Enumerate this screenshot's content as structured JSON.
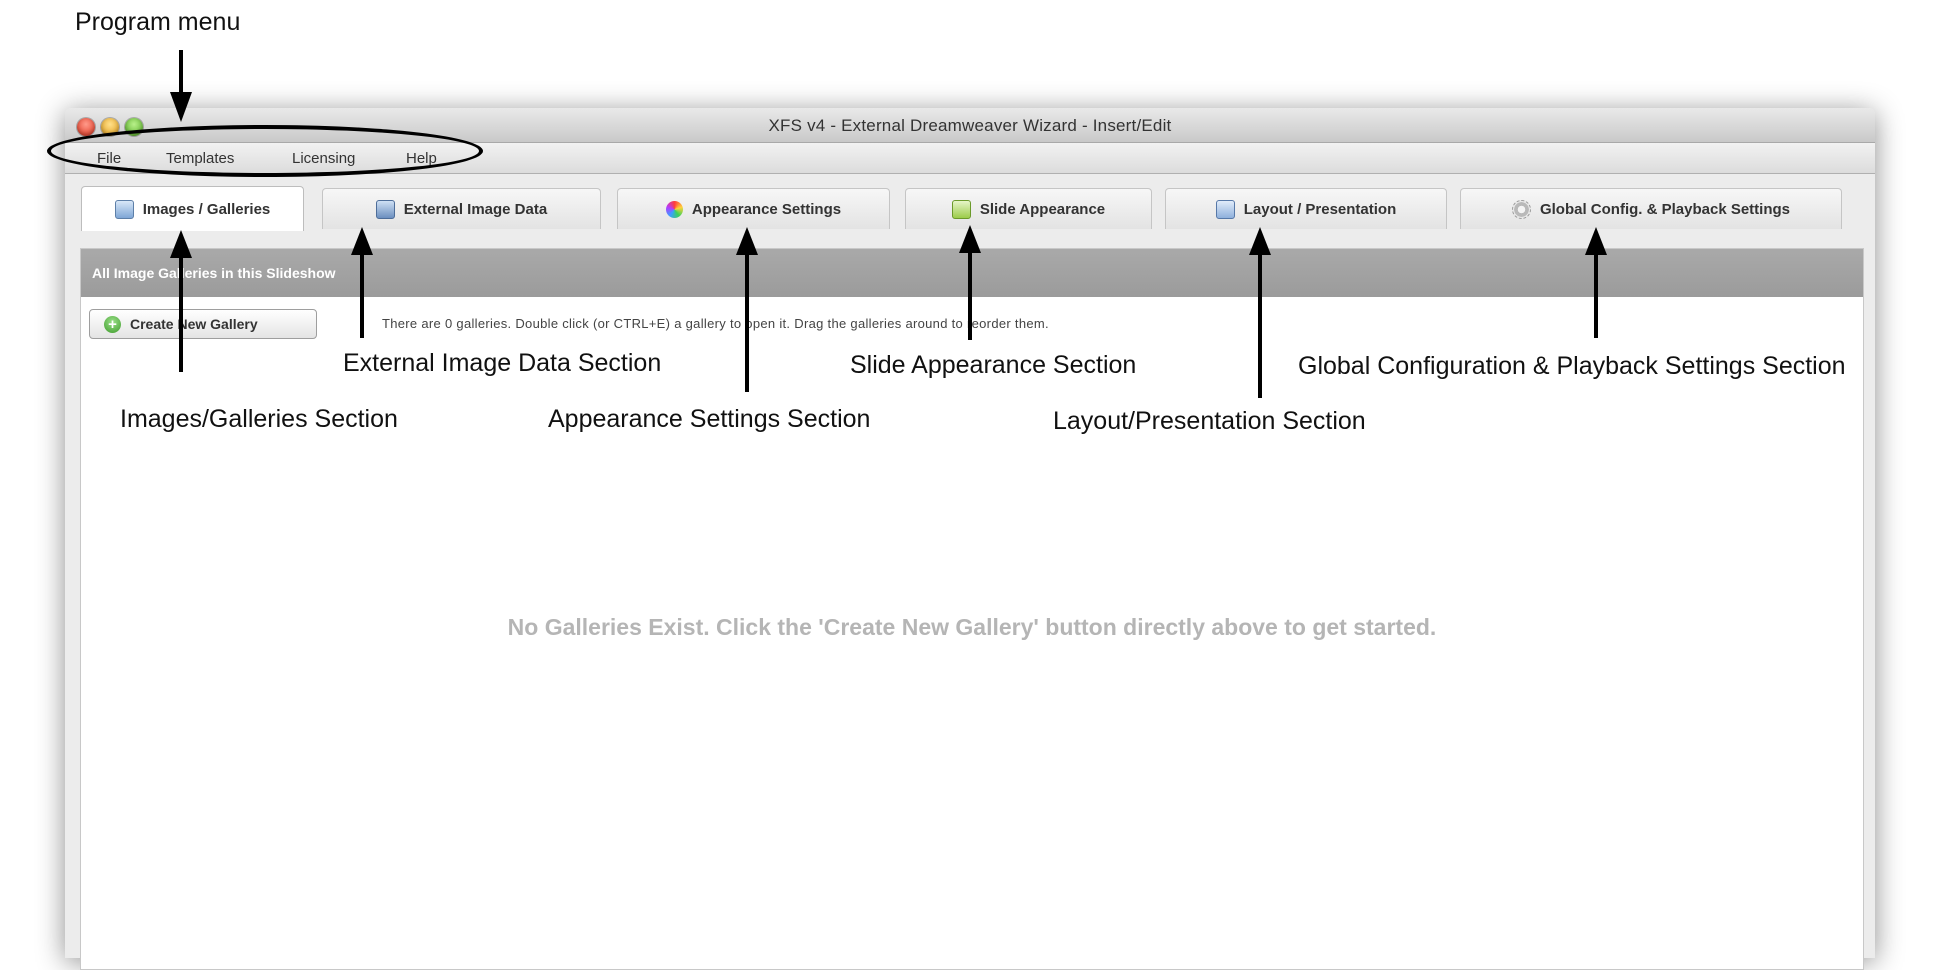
{
  "window": {
    "title": "XFS v4 - External Dreamweaver Wizard - Insert/Edit"
  },
  "menu": [
    "File",
    "Templates",
    "Licensing",
    "Help"
  ],
  "tabs": [
    {
      "label": "Images / Galleries",
      "icon": "images-icon",
      "active": true
    },
    {
      "label": "External Image Data",
      "icon": "external-image-icon",
      "active": false
    },
    {
      "label": "Appearance Settings",
      "icon": "color-wheel-icon",
      "active": false
    },
    {
      "label": "Slide Appearance",
      "icon": "slide-icon",
      "active": false
    },
    {
      "label": "Layout / Presentation",
      "icon": "layout-icon",
      "active": false
    },
    {
      "label": "Global Config. & Playback Settings",
      "icon": "gear-icon",
      "active": false
    }
  ],
  "content": {
    "section_header": "All Image Galleries in this Slideshow",
    "create_button": "Create New Gallery",
    "info_text": "There are 0 galleries.  Double click (or CTRL+E) a gallery to open it.  Drag the galleries around to reorder them.",
    "empty_message": "No Galleries Exist.  Click the 'Create New Gallery' button directly above to get started."
  },
  "annotations": {
    "program_menu": "Program menu",
    "images_galleries": "Images/Galleries Section",
    "external_image_data": "External Image Data Section",
    "appearance_settings": "Appearance Settings Section",
    "slide_appearance": "Slide Appearance Section",
    "layout_presentation": "Layout/Presentation Section",
    "global_config": "Global Configuration & Playback Settings Section"
  }
}
